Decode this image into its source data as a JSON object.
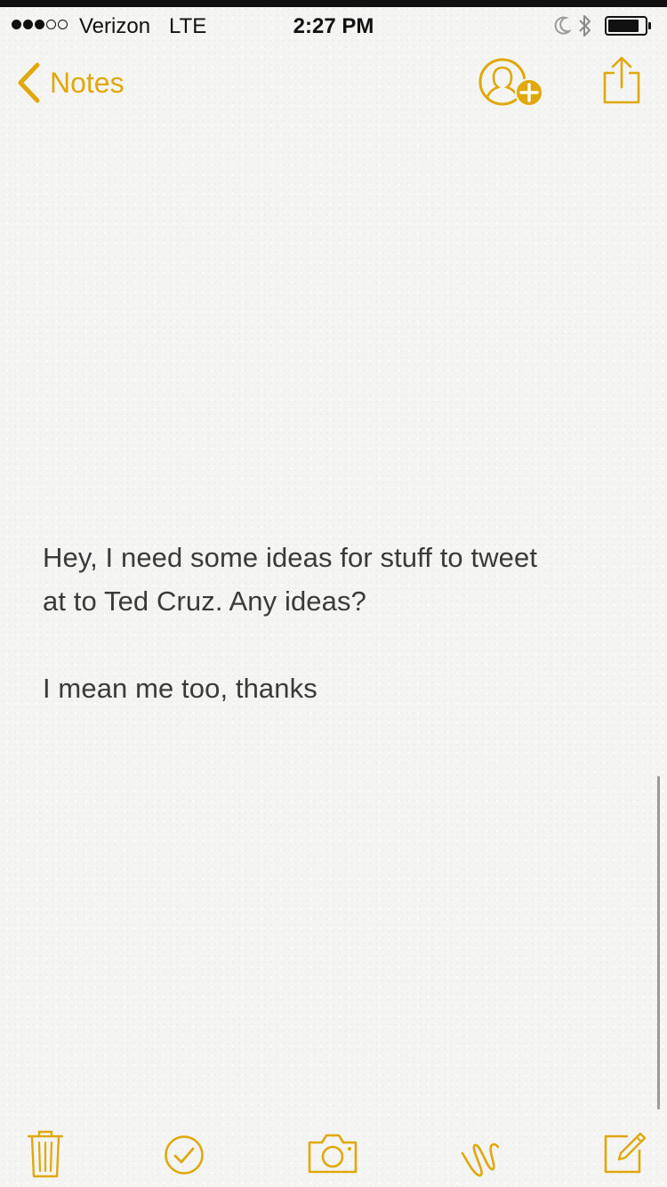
{
  "status_bar": {
    "signal": "●●●○○",
    "carrier": "Verizon",
    "network": "LTE",
    "time": "2:27 PM",
    "icons": [
      "moon-icon",
      "bluetooth-icon",
      "battery-icon"
    ]
  },
  "nav": {
    "back_label": "Notes",
    "icons": [
      "chevron-left-icon",
      "add-people-icon",
      "share-icon"
    ]
  },
  "note": {
    "paragraphs": [
      [
        "Hey, I need some ideas for stuff to tweet",
        "at to Ted Cruz. Any ideas?"
      ],
      [
        "I mean me too, thanks"
      ]
    ]
  },
  "toolbar": {
    "icons": [
      "trash-icon",
      "checklist-icon",
      "camera-icon",
      "sketch-icon",
      "compose-icon"
    ]
  },
  "colors": {
    "accent": "#e0a80a",
    "background": "#f4f4f2",
    "text": "#3a3a3a"
  }
}
